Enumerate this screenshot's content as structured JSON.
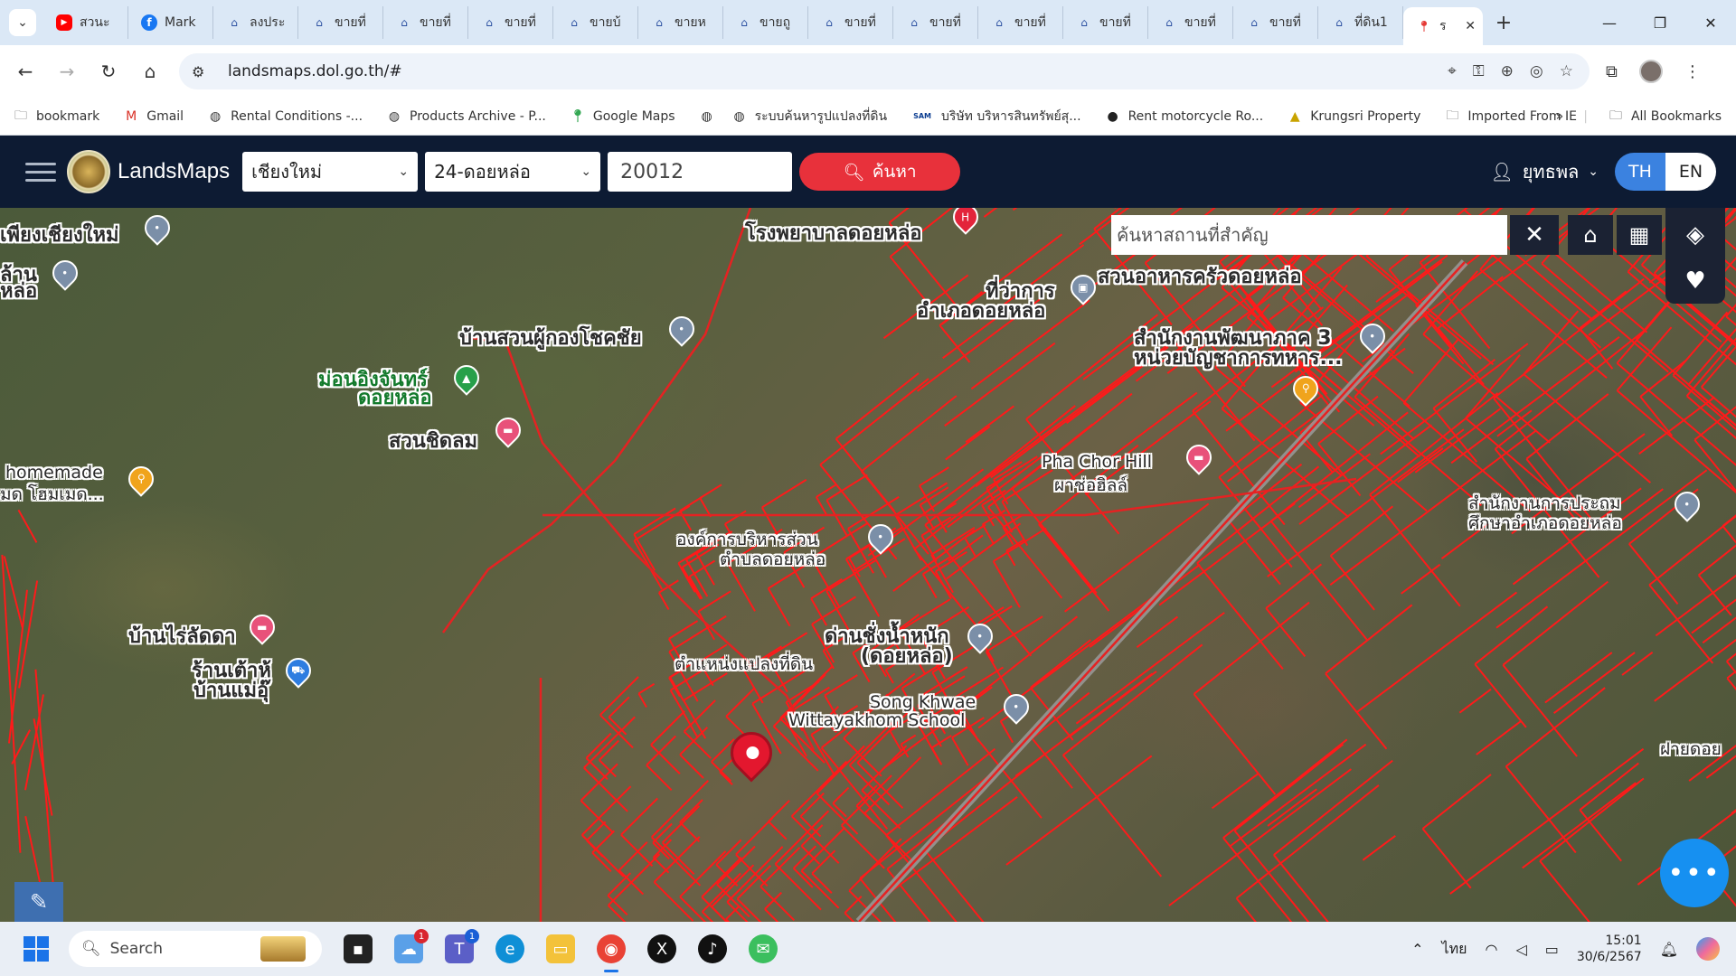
{
  "browser": {
    "tabs": [
      {
        "title": "สวนะ",
        "icon": "youtube-icon"
      },
      {
        "title": "Mark",
        "icon": "facebook-icon"
      },
      {
        "title": "ลงประ",
        "icon": "home-icon"
      },
      {
        "title": "ขายที่",
        "icon": "home-icon"
      },
      {
        "title": "ขายที่",
        "icon": "home-icon"
      },
      {
        "title": "ขายที่",
        "icon": "home-icon"
      },
      {
        "title": "ขายบ้",
        "icon": "home-icon"
      },
      {
        "title": "ขายห",
        "icon": "home-icon"
      },
      {
        "title": "ขายถู",
        "icon": "home-icon"
      },
      {
        "title": "ขายที่",
        "icon": "home-icon"
      },
      {
        "title": "ขายที่",
        "icon": "home-icon"
      },
      {
        "title": "ขายที่",
        "icon": "home-icon"
      },
      {
        "title": "ขายที่",
        "icon": "home-icon"
      },
      {
        "title": "ขายที่",
        "icon": "home-icon"
      },
      {
        "title": "ขายที่",
        "icon": "home-icon"
      },
      {
        "title": "ที่ดิน1",
        "icon": "home-icon"
      }
    ],
    "active_tab": {
      "title": "ร",
      "icon": "map-pin-icon"
    },
    "url": "landsmaps.dol.go.th/#",
    "bookmarks": [
      {
        "label": "bookmark",
        "icon": "folder-icon"
      },
      {
        "label": "Gmail",
        "icon": "gmail-icon"
      },
      {
        "label": "Rental Conditions -...",
        "icon": "globe-icon"
      },
      {
        "label": "Products Archive - P...",
        "icon": "globe-icon"
      },
      {
        "label": "Google Maps",
        "icon": "google-maps-icon"
      },
      {
        "label": "",
        "icon": "globe-icon"
      },
      {
        "label": "ระบบค้นหารูปแปลงที่ดิน",
        "icon": "globe-icon"
      },
      {
        "label": "บริษัท บริหารสินทรัพย์สุ...",
        "icon": "sam-icon"
      },
      {
        "label": "Rent motorcycle Ro...",
        "icon": "moto-icon"
      },
      {
        "label": "Krungsri Property",
        "icon": "krungsri-icon"
      },
      {
        "label": "Imported From IE",
        "icon": "folder-icon"
      }
    ],
    "all_bookmarks": "All Bookmarks"
  },
  "app": {
    "brand": "LandsMaps",
    "province": "เชียงใหม่",
    "amphoe": "24-ดอยหล่อ",
    "parcel_number": "20012",
    "search_label": "ค้นหา",
    "user": "ยุทธพล",
    "lang_th": "TH",
    "lang_en": "EN",
    "place_search_placeholder": "ค้นหาสถานที่สำคัญ"
  },
  "map": {
    "labels": [
      {
        "text": "โรงพยาบาลดอยหล่อ"
      },
      {
        "text": "สวนอาหารครัวดอยหล่อ"
      },
      {
        "text": "ที่ว่าการ"
      },
      {
        "text": "อำเภอดอยหล่อ"
      },
      {
        "text": "เพียงเชียงใหม่"
      },
      {
        "text": "ล้าน"
      },
      {
        "text": "หล่อ"
      },
      {
        "text": "บ้านสวนผู้กองโชคชัย"
      },
      {
        "text": "ม่อนอิงจันทร์"
      },
      {
        "text": "ดอยหล่อ"
      },
      {
        "text": "สวนชิดลม"
      },
      {
        "text": "สำนักงานพัฒนาภาค 3"
      },
      {
        "text": "หน่วยบัญชาการทหาร..."
      },
      {
        "text": "Pha Chor Hill"
      },
      {
        "text": "ผาช่อฮิลล์"
      },
      {
        "text": "homemade"
      },
      {
        "text": "มด โฮมเมด..."
      },
      {
        "text": "องค์การบริหารส่วน"
      },
      {
        "text": "ตำบลดอยหล่อ"
      },
      {
        "text": "สำนักงานการประถม"
      },
      {
        "text": "ศึกษาอำเภอดอยหล่อ"
      },
      {
        "text": "บ้านไร่ลัดดา"
      },
      {
        "text": "ด่านชั่งน้ำหนัก"
      },
      {
        "text": "(ดอยหล่อ)"
      },
      {
        "text": "ตำแหน่งแปลงที่ดิน"
      },
      {
        "text": "ร้านเต้าหู้"
      },
      {
        "text": "บ้านแม่อุ๊"
      },
      {
        "text": "Song Khwae"
      },
      {
        "text": "Wittayakhom School"
      },
      {
        "text": "ฝายดอย"
      }
    ]
  },
  "taskbar": {
    "search_placeholder": "Search",
    "badge_weather": "1",
    "badge_teams": "1",
    "lang": "ไทย",
    "time": "15:01",
    "date": "30/6/2567"
  }
}
